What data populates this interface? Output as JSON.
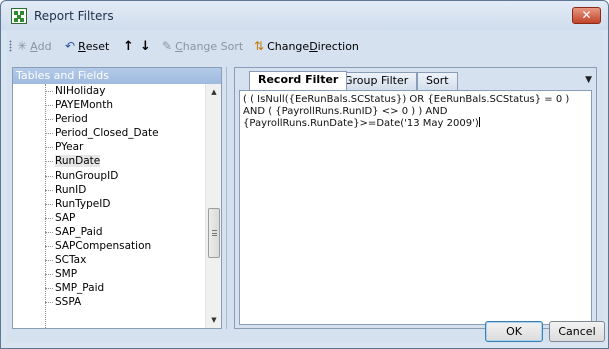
{
  "window": {
    "title": "Report Filters",
    "close_symbol": "✕"
  },
  "toolbar": {
    "add": {
      "access_key": "A",
      "rest": "dd",
      "icon": "add-icon"
    },
    "reset": {
      "access_key": "R",
      "rest": "eset",
      "icon": "undo-icon"
    },
    "move_up_icon": "arrow-up-icon",
    "move_down_icon": "arrow-down-icon",
    "change_sort": {
      "access_key": "C",
      "rest": "hange Sort",
      "icon": "edit-icon"
    },
    "change_direction": {
      "prefix": "Change ",
      "access_key": "D",
      "rest": "irection",
      "icon": "sort-direction-icon"
    }
  },
  "sidebar": {
    "header": "Tables and Fields",
    "items": [
      "NIHoliday",
      "PAYEMonth",
      "Period",
      "Period_Closed_Date",
      "PYear",
      "RunDate",
      "RunGroupID",
      "RunID",
      "RunTypeID",
      "SAP",
      "SAP_Paid",
      "SAPCompensation",
      "SCTax",
      "SMP",
      "SMP_Paid",
      "SSPA"
    ],
    "selected_item": "RunDate"
  },
  "tabs": [
    {
      "label": "Record Filter",
      "active": true
    },
    {
      "label": "Group Filter",
      "active": false
    },
    {
      "label": "Sort",
      "active": false
    }
  ],
  "editor": {
    "text": "( ( IsNull({EeRunBals.SCStatus}) OR {EeRunBals.SCStatus} = 0 ) AND ( {PayrollRuns.RunID} <> 0 ) ) AND {PayrollRuns.RunDate}>=Date('13 May 2009')"
  },
  "buttons": {
    "ok": "OK",
    "cancel": "Cancel"
  }
}
